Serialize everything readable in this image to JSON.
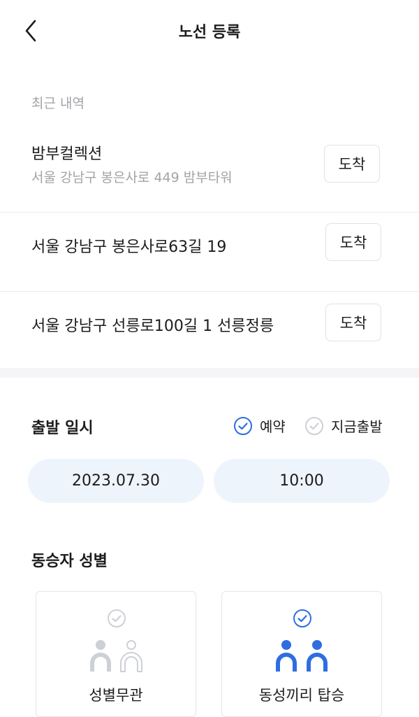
{
  "header": {
    "title": "노선 등록",
    "back_icon": "chevron-left-icon"
  },
  "recent": {
    "label": "최근 내역",
    "items": [
      {
        "name": "밤부컬렉션",
        "address": "서울 강남구 봉은사로 449 밤부타워",
        "button": "도착"
      },
      {
        "address": "서울 강남구 봉은사로63길 19",
        "button": "도착"
      },
      {
        "address": "서울 강남구 선릉로100길 1 선릉정릉",
        "button": "도착"
      }
    ]
  },
  "departure": {
    "title": "출발 일시",
    "options": [
      {
        "label": "예약",
        "selected": true
      },
      {
        "label": "지금출발",
        "selected": false
      }
    ],
    "date": "2023.07.30",
    "time": "10:00"
  },
  "gender": {
    "title": "동승자 성별",
    "options": [
      {
        "label": "성별무관",
        "selected": false,
        "icon": "people-icon"
      },
      {
        "label": "동성끼리 탑승",
        "selected": true,
        "icon": "people-icon"
      }
    ]
  },
  "colors": {
    "accent": "#2f6de1",
    "muted_icon": "#cdd0d6",
    "pill_bg": "#eef4fb",
    "text_secondary": "#a3a3a8"
  }
}
